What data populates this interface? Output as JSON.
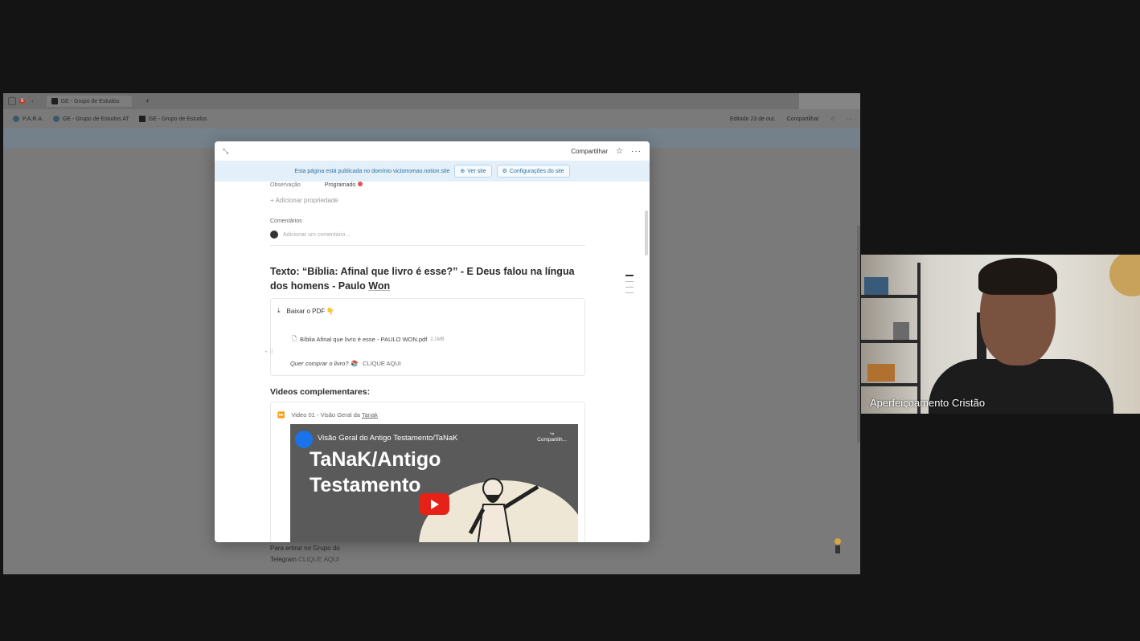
{
  "browser": {
    "tab_badge": "6",
    "tab_title": "GE - Grupo de Estudos",
    "new_tab": "+",
    "bookmarks": [
      "P.A.R.A.",
      "GE - Grupo de Estudos AT",
      "GE - Grupo de Estudos"
    ],
    "edited": "Editado 23 de out.",
    "share": "Compartilhar",
    "pub_text": "Esta página está publicada no domínio victorromao.notion.site",
    "view_site": "Ver site",
    "site_config": "Configurações do site"
  },
  "modal": {
    "share": "Compartilhar",
    "publish_notice": "Esta página está publicada no domínio victorromao.notion.site",
    "view_site": "Ver site",
    "site_settings": "Configurações do site",
    "property_name": "Observação",
    "property_value": "Programado",
    "add_property": "Adicionar propriedade",
    "comments_heading": "Comentários",
    "comment_placeholder": "Adicionar um comentário...",
    "heading_prefix": "Texto:  “Bíblia: Afinal que livro é esse?” - E Deus falou na língua dos homens - Paulo ",
    "heading_underlined": "Won",
    "download_pdf": "Baixar o PDF 👇",
    "file_name": "Bíblia Afinal que livro é esse - PAULO WON.pdf",
    "file_size": "2.1MB",
    "buy_question": "Quer comprar o livro? 📚",
    "buy_link": "CLIQUE AQUI",
    "videos_heading": "Videos complementares:",
    "video_label_prefix": "Video 01 - Visão Geral da ",
    "video_label_underlined": "Tanak",
    "video_title": "Visão Geral do Antigo Testamento/TaNaK",
    "video_share": "Compartilh...",
    "video_big_line1": "TaNaK/Antigo",
    "video_big_line2": "Testamento"
  },
  "page_bottom": {
    "telegram_line1": "Para entrar no Grupo do",
    "telegram_line2_prefix": "Telegram ",
    "telegram_link": "CLIQUE AQUI"
  },
  "webcam": {
    "participant_name": "Aperfeiçoamento Cristão"
  }
}
